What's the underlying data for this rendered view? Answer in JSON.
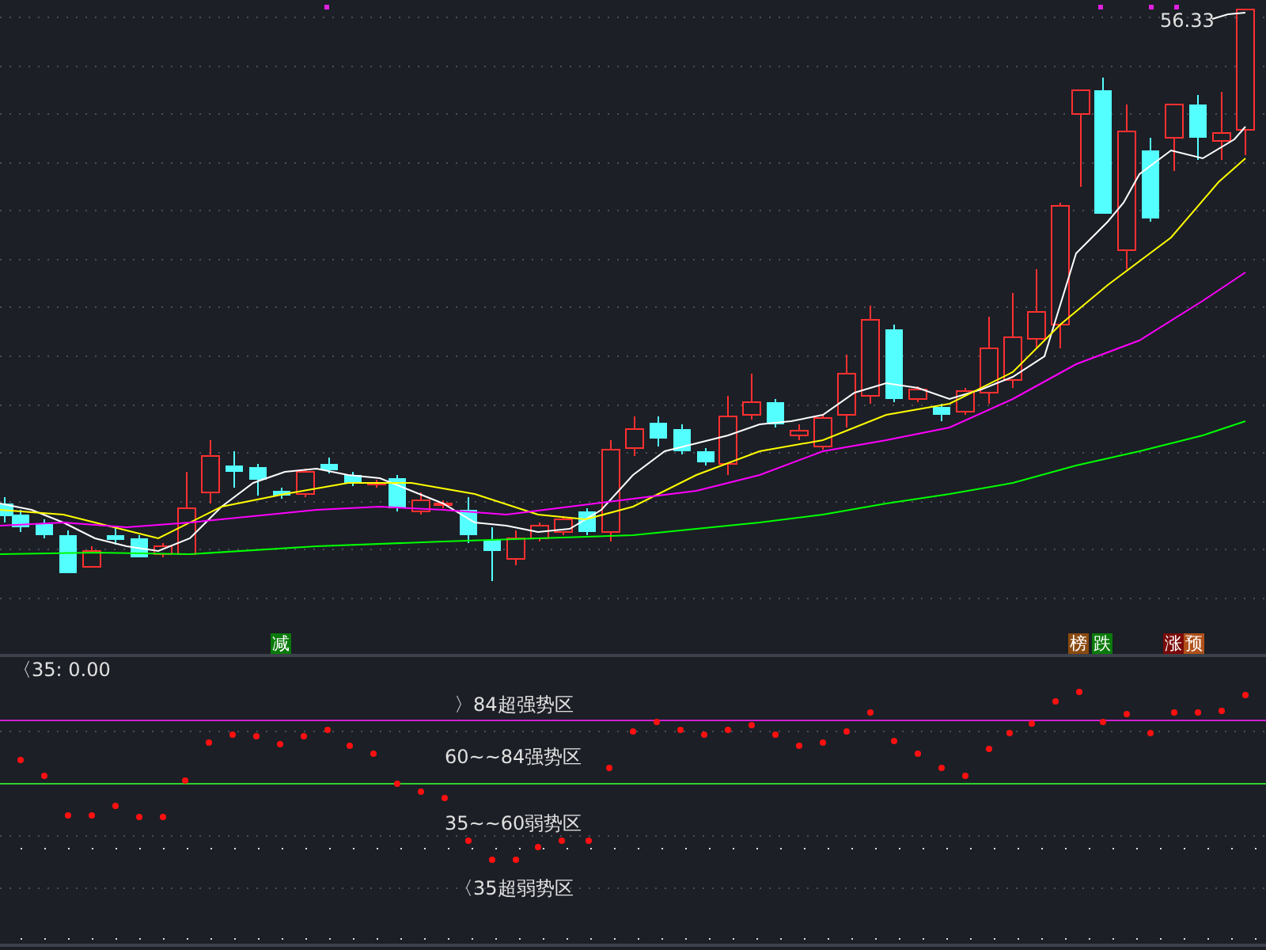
{
  "price_chart": {
    "high_label": "56.33",
    "signals": [
      {
        "text": "减",
        "color": "#0a7a0a"
      },
      {
        "text": "榜",
        "color": "#8a4a10"
      },
      {
        "text": "跌",
        "color": "#0a7a0a"
      },
      {
        "text": "涨",
        "color": "#7a0a0a"
      },
      {
        "text": "预",
        "color": "#b0501a"
      }
    ]
  },
  "indicator": {
    "header": "〈35: 0.00",
    "zones": [
      "〉84超强势区",
      "60~~84强势区",
      "35~~60弱势区",
      "〈35超弱势区"
    ]
  }
}
